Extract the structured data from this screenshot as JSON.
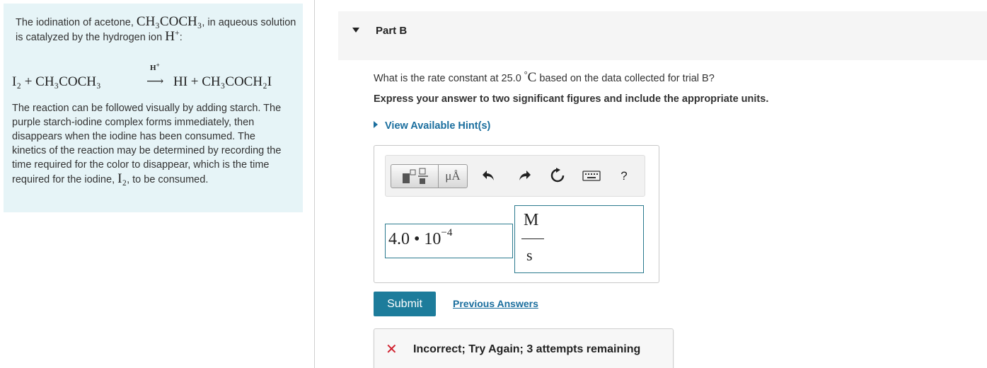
{
  "intro": {
    "text1_a": "The iodination of acetone, ",
    "acetone_formula": "CH₃COCH₃",
    "text1_b": ", in aqueous solution is catalyzed by the hydrogen ion ",
    "hydrogen_ion": "H",
    "hydrogen_charge": "+",
    "text1_c": ":",
    "equation": {
      "lhs": "I₂ + CH₃COCH₃",
      "catalyst": "H",
      "catalyst_charge": "+",
      "arrow": "⟶",
      "rhs": "HI + CH₃COCH₂I"
    },
    "text2_a": "The reaction can be followed visually by adding starch. The purple starch-iodine complex forms immediately, then disappears when the iodine has been consumed. The kinetics of the reaction may be determined by recording the time required for the color to disappear, which is the time required for the iodine, ",
    "iodine_formula": "I₂",
    "text2_b": ", to be consumed."
  },
  "part": {
    "title": "Part B"
  },
  "question": {
    "text_a": "What is the rate constant at 25.0 ",
    "degree": "°",
    "unit_c": "C",
    "text_b": " based on the data collected for trial B?"
  },
  "instruction": "Express your answer to two significant figures and include the appropriate units.",
  "hints": {
    "label": "View Available Hint(s)"
  },
  "toolbar": {
    "units_label": "μÅ",
    "help_label": "?"
  },
  "answer": {
    "value_mantissa": "4.0",
    "value_dot": "•",
    "value_base": "10",
    "value_exponent": "−4",
    "unit_numerator": "M",
    "unit_denominator": "s"
  },
  "submit_label": "Submit",
  "previous_answers_label": "Previous Answers",
  "feedback": {
    "icon": "✕",
    "text": "Incorrect; Try Again; 3 attempts remaining",
    "color": "#d0202e"
  },
  "colors": {
    "intro_background": "#e6f4f7",
    "link": "#1a6e9e",
    "submit_background": "#1d7c9b",
    "input_border": "#2b7a8e"
  }
}
